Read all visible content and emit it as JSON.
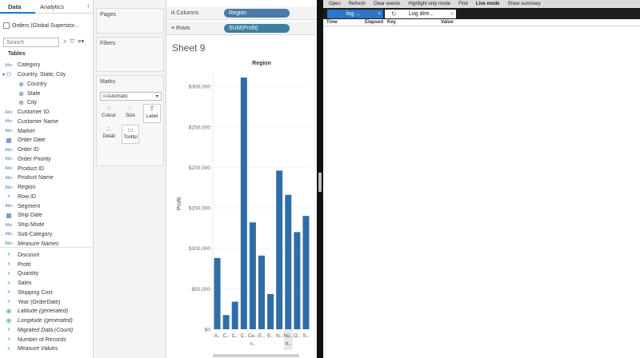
{
  "data_pane": {
    "tabs": [
      "Data",
      "Analytics"
    ],
    "collapse_glyph": "‹",
    "datasource": "Orders (Global Superstor...",
    "search_placeholder": "Search",
    "tables_header": "Tables",
    "fields": [
      {
        "type": "Abc",
        "label": "Category"
      },
      {
        "type": "hier",
        "label": "Country, State, City"
      },
      {
        "type": "geo",
        "label": "Country",
        "indent": true
      },
      {
        "type": "geo",
        "label": "State",
        "indent": true
      },
      {
        "type": "geo",
        "label": "City",
        "indent": true
      },
      {
        "type": "Abc",
        "label": "Customer ID"
      },
      {
        "type": "Abc",
        "label": "Customer Name"
      },
      {
        "type": "Abc",
        "label": "Market"
      },
      {
        "type": "date",
        "label": "Order Date"
      },
      {
        "type": "Abc",
        "label": "Order ID"
      },
      {
        "type": "Abc",
        "label": "Order Priority"
      },
      {
        "type": "Abc",
        "label": "Product ID"
      },
      {
        "type": "Abc",
        "label": "Product Name"
      },
      {
        "type": "Abc",
        "label": "Region"
      },
      {
        "type": "#",
        "label": "Row ID"
      },
      {
        "type": "Abc",
        "label": "Segment"
      },
      {
        "type": "date",
        "label": "Ship Date"
      },
      {
        "type": "Abc",
        "label": "Ship Mode"
      },
      {
        "type": "Abc",
        "label": "Sub-Category"
      },
      {
        "type": "Abc",
        "label": "Measure Names",
        "italic": true
      },
      {
        "type": "#",
        "label": "Discount",
        "measure": true
      },
      {
        "type": "#",
        "label": "Profit",
        "measure": true
      },
      {
        "type": "#",
        "label": "Quantity",
        "measure": true
      },
      {
        "type": "#",
        "label": "Sales",
        "measure": true
      },
      {
        "type": "#",
        "label": "Shipping Cost",
        "measure": true
      },
      {
        "type": "#",
        "label": "Year (OrderDate)",
        "measure": true
      },
      {
        "type": "geo",
        "label": "Latitude (generated)",
        "italic": true,
        "measure": true
      },
      {
        "type": "geo",
        "label": "Longitude (generated)",
        "italic": true,
        "measure": true
      },
      {
        "type": "#",
        "label": "Migrated Data (Count)",
        "italic": true,
        "measure": true
      },
      {
        "type": "#",
        "label": "Number of Records",
        "measure": true
      },
      {
        "type": "#",
        "label": "Measure Values",
        "italic": true,
        "measure": true
      }
    ]
  },
  "cards": {
    "pages": "Pages",
    "filters": "Filters",
    "marks": "Marks",
    "marks_type": "Automatic",
    "mark_buttons": [
      "Colour",
      "Size",
      "Label",
      "Detail",
      "Tooltip"
    ]
  },
  "shelves": {
    "columns_label": "Columns",
    "columns_pill": "Region",
    "rows_label": "Rows",
    "rows_pill": "SUM(Profit)"
  },
  "sheet_title": "Sheet 9",
  "chart_data": {
    "type": "bar",
    "title": "Region",
    "ylabel": "Profit",
    "ylim": [
      0,
      310000
    ],
    "yticks": [
      0,
      50000,
      100000,
      150000,
      200000,
      250000,
      300000
    ],
    "ytick_labels": [
      "$0",
      "$50,000",
      "$100,000",
      "$150,000",
      "$200,000",
      "$250,000",
      "$300,000"
    ],
    "categories": [
      "A..",
      "C..",
      "C..",
      "C..",
      "Ce..",
      "E..",
      "E..",
      "N..",
      "No..",
      "O..",
      "S.."
    ],
    "category_labels_line2": [
      "",
      "",
      "",
      "",
      "n..",
      "",
      "",
      "",
      "rt..",
      "",
      ""
    ],
    "values": [
      88000,
      17500,
      34000,
      311000,
      132000,
      91000,
      43500,
      196000,
      166000,
      120000,
      140000
    ],
    "highlighted_index": 8,
    "color": "#2f6da6"
  },
  "log_viewer": {
    "menu": [
      "Open",
      "Refresh",
      "Clear events",
      "Highlight only mode",
      "Find",
      "Live mode",
      "Show summary"
    ],
    "active_menu": "Live mode",
    "tab1": "log ...",
    "tab2": "Log dire...",
    "columns": [
      "Time",
      "Elapsed",
      "Key",
      "Value"
    ]
  }
}
